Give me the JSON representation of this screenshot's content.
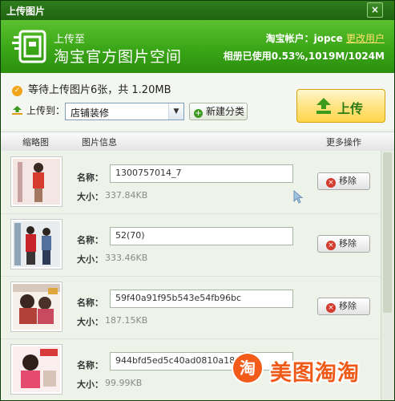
{
  "window": {
    "title": "上传图片",
    "close_symbol": "×"
  },
  "banner": {
    "subtitle": "上传至",
    "title": "淘宝官方图片空间",
    "account_label": "淘宝帐户：jopce",
    "switch_user": "更改用户",
    "usage": "相册已使用0.53%,1019M/1024M"
  },
  "summary": {
    "waiting_text": "等待上传图片6张，共 1.20MB"
  },
  "destination": {
    "label": "上传到：",
    "selected": "店铺装修",
    "new_category_label": "新建分类"
  },
  "upload_button": {
    "label": "上传"
  },
  "columns": {
    "thumbnail": "缩略图",
    "info": "图片信息",
    "more_actions": "更多操作"
  },
  "row_labels": {
    "name": "名称：",
    "size": "大小：",
    "remove": "移除"
  },
  "images": [
    {
      "name": "1300757014_7",
      "size": "337.84KB"
    },
    {
      "name": "52(70)",
      "size": "333.46KB"
    },
    {
      "name": "59f40a91f95b543e54fb96bc",
      "size": "187.15KB"
    },
    {
      "name": "944bfd5ed5c40ad0810a18ff",
      "size": "99.99KB"
    }
  ],
  "watermark": {
    "logo_char": "淘",
    "text": "美图淘淘"
  },
  "colors": {
    "brand_green": "#3aa617",
    "upload_button": "#ffd54a",
    "remove_icon": "#d23b2e"
  }
}
